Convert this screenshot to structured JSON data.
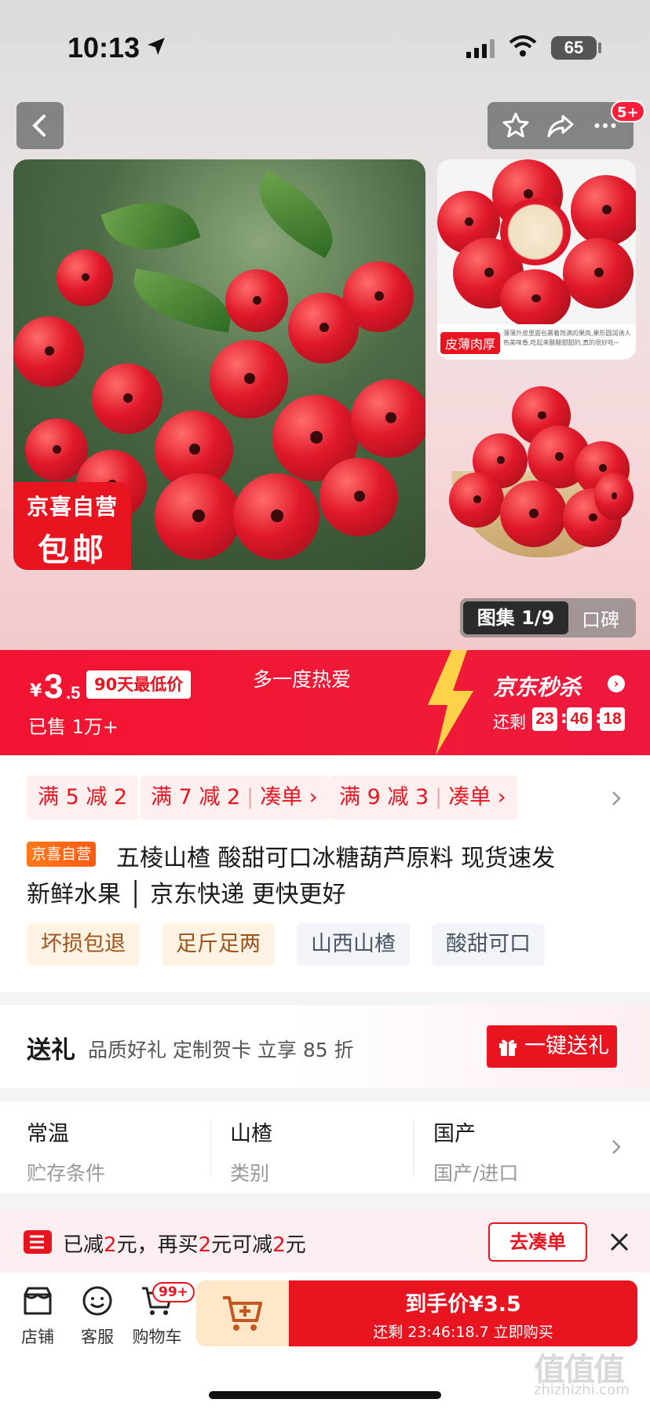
{
  "status_bar": {
    "time": "10:13",
    "battery": "65"
  },
  "header": {
    "more_badge": "5+"
  },
  "main_image": {
    "promo_line1": "京喜自营",
    "promo_line2": "包邮"
  },
  "side_image1": {
    "tag": "皮薄肉厚",
    "caption": "薄薄外皮里面包裹着饱满的果肉,果形圆润诱人色美味香,吃起来酸酸甜甜的,真的很好吃~"
  },
  "gallery": {
    "active": "图集 1/9",
    "inactive": "口碑"
  },
  "price_banner": {
    "yen": "¥",
    "price_int": "3",
    "price_dec": ".5",
    "lowest_badge": "90天最低价",
    "sold": "已售 1万+",
    "slogan": "多一度热爱",
    "seckill_title": "京东秒杀",
    "remain_label": "还剩",
    "countdown": [
      "23",
      "46",
      "18"
    ]
  },
  "coupons": [
    {
      "text": "满 5 减 2"
    },
    {
      "text": "满 7 减 2",
      "action": "凑单 ›"
    },
    {
      "text": "满 9 减 3",
      "action": "凑单 ›"
    }
  ],
  "product": {
    "self_tag": "京喜自营",
    "title_line1": "五棱山楂 酸甜可口冰糖葫芦原料 现货速发",
    "title_line2": "新鲜水果 │ 京东快递 更快更好",
    "features": [
      "坏损包退",
      "足斤足两",
      "山西山楂",
      "酸甜可口"
    ]
  },
  "gift": {
    "title": "送礼",
    "desc": "品质好礼 定制贺卡 立享 85 折",
    "button": "一键送礼"
  },
  "specs": [
    {
      "value": "常温",
      "key": "贮存条件"
    },
    {
      "value": "山楂",
      "key": "类别"
    },
    {
      "value": "国产",
      "key": "国产/进口"
    }
  ],
  "discount": {
    "p1": "已减",
    "a1": "2",
    "p2": "元，再买",
    "a2": "2",
    "p3": "元可减",
    "a3": "2",
    "p4": "元",
    "button": "去凑单"
  },
  "bottom_bar": {
    "shop": "店铺",
    "service": "客服",
    "cart": "购物车",
    "cart_badge": "99+",
    "buy_line1": "到手价¥3.5",
    "buy_line2": "还剩 23:46:18.7 立即购买"
  },
  "watermark": {
    "main": "值值值",
    "sub": "zhizhizhi.com"
  },
  "colors": {
    "accent": "#e8141f",
    "warm_tag_bg": "#fff3e3",
    "add_cart_bg": "#ffe7c7"
  }
}
